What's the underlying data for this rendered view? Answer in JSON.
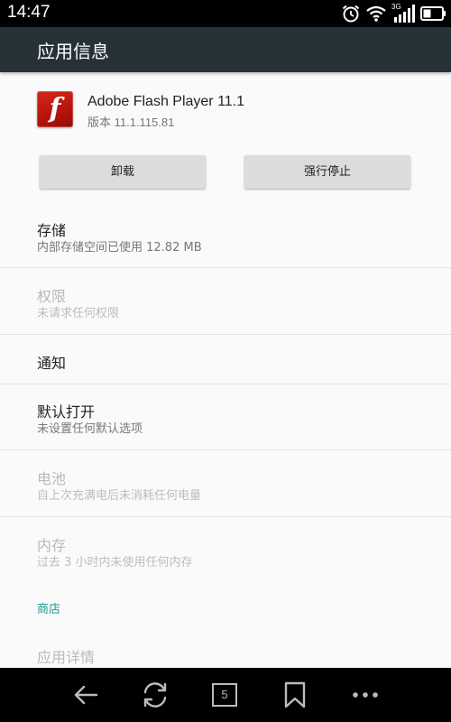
{
  "status_bar": {
    "time": "14:47",
    "network_label": "3G",
    "icons": [
      "alarm-icon",
      "wifi-icon",
      "signal-icon",
      "battery-icon"
    ]
  },
  "app_bar": {
    "title": "应用信息"
  },
  "app": {
    "name": "Adobe Flash Player 11.1",
    "version": "版本 11.1.115.81",
    "logo_letter": "f",
    "logo_color": "#c41e13"
  },
  "actions": {
    "uninstall": "卸载",
    "force_stop": "强行停止"
  },
  "sections": {
    "storage": {
      "title": "存储",
      "summary": "内部存储空间已使用 12.82 MB"
    },
    "permissions": {
      "title": "权限",
      "summary": "未请求任何权限"
    },
    "notifications": {
      "title": "通知"
    },
    "open_by_default": {
      "title": "默认打开",
      "summary": "未设置任何默认选项"
    },
    "battery": {
      "title": "电池",
      "summary": "自上次充满电后未消耗任何电量"
    },
    "memory": {
      "title": "内存",
      "summary": "过去 3 小时内未使用任何内存"
    },
    "store_category": {
      "title": "商店"
    },
    "app_details": {
      "title": "应用详情"
    }
  },
  "nav_bar": {
    "tab_count": "5",
    "buttons": [
      "back-icon",
      "refresh-icon",
      "tabs-icon",
      "bookmark-icon",
      "more-icon"
    ]
  },
  "colors": {
    "app_bar": "#263238",
    "accent": "#1a9b8c",
    "background": "#fafafa"
  }
}
